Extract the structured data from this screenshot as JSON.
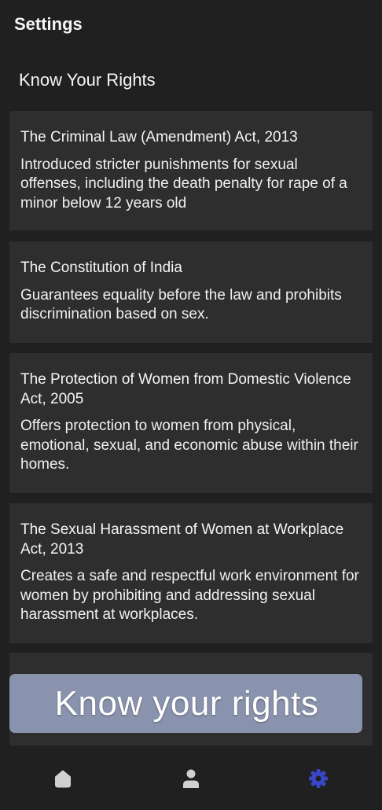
{
  "app_bar": {
    "title": "Settings"
  },
  "section": {
    "title": "Know Your Rights"
  },
  "cards": [
    {
      "title": "The Criminal Law (Amendment) Act, 2013",
      "description": "Introduced stricter punishments for sexual offenses, including the death penalty for rape of a minor below 12 years old"
    },
    {
      "title": "The Constitution of India",
      "description": "Guarantees equality before the law and prohibits discrimination based on sex."
    },
    {
      "title": "The Protection of Women from Domestic Violence Act, 2005",
      "description": "Offers protection to women from physical, emotional, sexual, and economic abuse within their homes."
    },
    {
      "title": "The Sexual Harassment of Women at Workplace Act, 2013",
      "description": "Creates a safe and respectful work environment for women by prohibiting and addressing sexual harassment at workplaces."
    }
  ],
  "banner": {
    "text": "Know your rights"
  },
  "bottom_nav": {
    "items": [
      {
        "icon": "home-icon",
        "selected": false
      },
      {
        "icon": "person-icon",
        "selected": false
      },
      {
        "icon": "gear-icon",
        "selected": true
      }
    ],
    "active_color": "#3a46c8",
    "inactive_color": "#d0d0d0"
  },
  "colors": {
    "background": "#202020",
    "card": "#2e2e2e",
    "banner": "#8a93ad"
  }
}
